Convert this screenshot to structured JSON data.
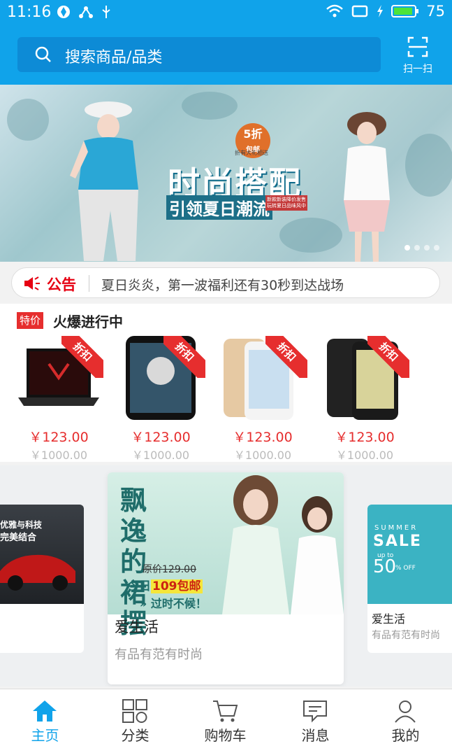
{
  "status_bar": {
    "time": "11:16",
    "battery": "75"
  },
  "search": {
    "placeholder": "搜索商品/品类",
    "scan_label": "扫一扫"
  },
  "banner": {
    "badge": "5折",
    "badge_sub": "包邮",
    "badge_note": "折有大礼相送",
    "title": "时尚搭配",
    "subtitle": "引领夏日潮流",
    "tag": "新款新装降价发售 玩转夏日品味风中",
    "slides": 4,
    "active_slide": 0
  },
  "notice": {
    "tag": "公告",
    "text": "夏日炎炎，第一波福利还有30秒到达战场"
  },
  "deals": {
    "badge": "特价",
    "title": "火爆进行中",
    "ribbon": "折扣",
    "items": [
      {
        "name": "laptop",
        "price": "￥123.00",
        "old_price": "￥1000.00"
      },
      {
        "name": "phone-samsung",
        "price": "￥123.00",
        "old_price": "￥1000.00"
      },
      {
        "name": "phone-oppo-gold",
        "price": "￥123.00",
        "old_price": "￥1000.00"
      },
      {
        "name": "phone-oppo-black",
        "price": "￥123.00",
        "old_price": "￥1000.00"
      }
    ]
  },
  "carousel": {
    "main": {
      "title": "爱生活",
      "subtitle": "有品有范有时尚",
      "poster_title": "飘逸的裙摆",
      "poster_price": "原价129.00",
      "poster_today": "今日",
      "poster_deal": "109包邮",
      "poster_hurry": "» 过时不候！"
    },
    "left": {
      "line1": "优雅与科技",
      "line2": "完美结合"
    },
    "right": {
      "title": "爱生活",
      "subtitle": "有品有范有时尚",
      "summer": "SUMMER",
      "sale": "SALE",
      "upto": "up to",
      "percent": "50",
      "off": "% OFF"
    }
  },
  "tabbar": {
    "items": [
      {
        "label": "主页",
        "icon": "home-icon"
      },
      {
        "label": "分类",
        "icon": "category-icon"
      },
      {
        "label": "购物车",
        "icon": "cart-icon"
      },
      {
        "label": "消息",
        "icon": "message-icon"
      },
      {
        "label": "我的",
        "icon": "user-icon"
      }
    ],
    "active": 0
  },
  "colors": {
    "primary": "#10a3ea",
    "accent": "#e62e2e",
    "notice_red": "#e60012"
  }
}
